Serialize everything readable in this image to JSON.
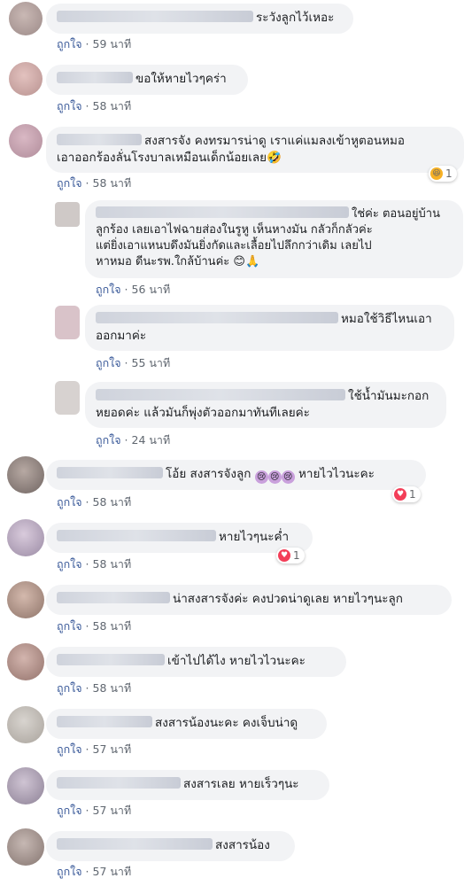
{
  "like_label": "ถูกใจ",
  "comments": [
    {
      "text": "ระวังลูกไว้เหอะ",
      "time": "59 นาที"
    },
    {
      "text": "ขอให้หายไวๆคร่า",
      "time": "58 นาที"
    },
    {
      "text_line1": "สงสารจัง คงทรมารน่าดู เราแค่แมลงเข้าหูตอนหมอ",
      "text_line2": "เอาออกร้องลั่นโรงบาลเหมือนเด็กน้อยเลย",
      "time": "58 นาที",
      "reaction_count": "1",
      "emoji": "🤣"
    },
    {
      "text_line1": "ใช่ค่ะ ตอนอยู่บ้าน",
      "text_line2": "ลูกร้อง เลยเอาไฟฉายส่องในรูหู เห็นหางมัน กลัวก็กลัวค่ะ",
      "text_line3": "แต่ยิ่งเอาแหนบดึงมันยิ่งกัดและเลื้อยไปลึกกว่าเดิม เลยไป",
      "text_line4": "หาหมอ ดีนะรพ.ใกล้บ้านค่ะ",
      "time": "56 นาที",
      "emoji1": "😊",
      "emoji2": "🙏"
    },
    {
      "text_line1": "หมอใช้วิธีไหนเอา",
      "text_line2": "ออกมาค่ะ",
      "time": "55 นาที"
    },
    {
      "text_line1": "ใช้น้ำมันมะกอก",
      "text_line2": "หยอดค่ะ แล้วมันก็พุ่งตัวออกมาทันทีเลยค่ะ",
      "time": "24 นาที"
    },
    {
      "text_a": "โอ้ย สงสารจังลูก",
      "text_b": "หายไวไวนะคะ",
      "time": "58 นาที",
      "reaction_count": "1"
    },
    {
      "text": "หายไวๆนะค่ำ",
      "time": "58 นาที",
      "reaction_count": "1"
    },
    {
      "text": "น่าสงสารจังค่ะ คงปวดน่าดูเลย หายไวๆนะลูก",
      "time": "58 นาที"
    },
    {
      "text": "เข้าไปได้ไง หายไวไวนะคะ",
      "time": "58 นาที"
    },
    {
      "text": "สงสารน้องนะคะ คงเจ็บน่าดู",
      "time": "57 นาที"
    },
    {
      "text": "สงสารเลย หายเร็วๆนะ",
      "time": "57 นาที"
    },
    {
      "text": "สงสารน้อง",
      "time": "57 นาที"
    }
  ],
  "colors": {
    "bubble": "#f2f3f5",
    "like_link": "#385898",
    "meta": "#606770",
    "heart": "#f33e58"
  },
  "icons": [
    "heart-reaction-icon",
    "haha-reaction-icon",
    "crying-emoji-icon"
  ]
}
